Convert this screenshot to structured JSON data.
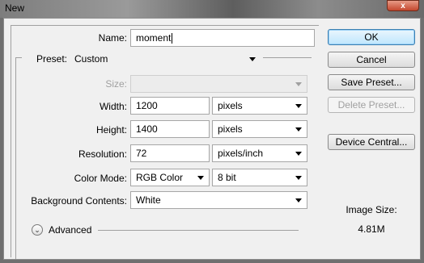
{
  "window": {
    "title": "New",
    "close_label": "x"
  },
  "form": {
    "name_label": "Name:",
    "name_value": "moment",
    "preset_label": "Preset:",
    "preset_value": "Custom",
    "size_label": "Size:",
    "size_value": "",
    "width_label": "Width:",
    "width_value": "1200",
    "width_unit": "pixels",
    "height_label": "Height:",
    "height_value": "1400",
    "height_unit": "pixels",
    "resolution_label": "Resolution:",
    "resolution_value": "72",
    "resolution_unit": "pixels/inch",
    "color_mode_label": "Color Mode:",
    "color_mode_value": "RGB Color",
    "bit_depth_value": "8 bit",
    "background_label": "Background Contents:",
    "background_value": "White",
    "advanced_label": "Advanced"
  },
  "buttons": {
    "ok": "OK",
    "cancel": "Cancel",
    "save_preset": "Save Preset...",
    "delete_preset": "Delete Preset...",
    "device_central": "Device Central..."
  },
  "info": {
    "image_size_label": "Image Size:",
    "image_size_value": "4.81M"
  }
}
